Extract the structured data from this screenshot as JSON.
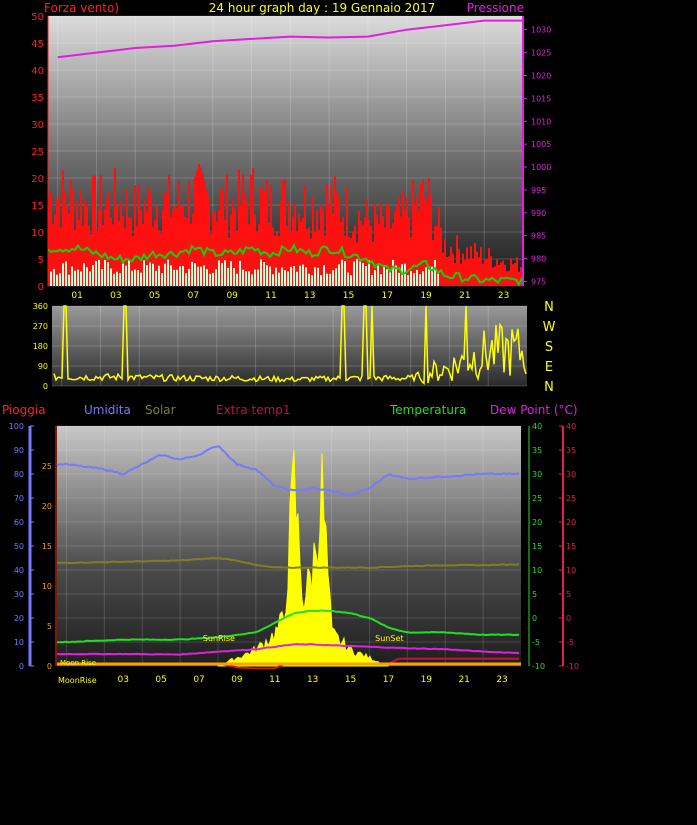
{
  "colors": {
    "background": "#000000",
    "wind": "#ff1010",
    "wind_avg": "#10d010",
    "gust_base": "#c8ffd8",
    "pressure": "#e020e0",
    "direction": "#ffff00",
    "humidity": "#7878ff",
    "solar": "#808020",
    "extra_temp": "#c01040",
    "temperature": "#20e020",
    "dew_point": "#e020e0",
    "rain": "#ffa000",
    "sun": "#ffff00",
    "hour_tick": "#ffff00"
  },
  "chart_data": [
    {
      "id": "wind-pressure",
      "type": "line",
      "title": "24 hour graph day : 19 Gennaio 2017",
      "left_label": "Forza vento)",
      "right_label": "Pressione",
      "x_ticks": [
        "01",
        "03",
        "05",
        "07",
        "09",
        "11",
        "13",
        "15",
        "17",
        "19",
        "21",
        "23"
      ],
      "y_left_ticks": [
        0,
        5,
        10,
        15,
        20,
        25,
        30,
        35,
        40,
        45,
        50
      ],
      "y_left_lim": [
        0,
        50
      ],
      "y_right_ticks": [
        975,
        980,
        985,
        990,
        995,
        1000,
        1005,
        1010,
        1015,
        1020,
        1025,
        1030
      ],
      "y_right_lim": [
        974,
        1033
      ],
      "grid": true,
      "series": [
        {
          "key": "wind_gust",
          "x": [
            0,
            1,
            2,
            3,
            4,
            5,
            6,
            7,
            8,
            9,
            10,
            11,
            12,
            13,
            14,
            15,
            16,
            17,
            18,
            19,
            20,
            21,
            22,
            23,
            24
          ],
          "values": [
            18,
            17,
            16,
            17,
            15,
            17,
            16,
            18,
            17,
            16,
            18,
            16,
            17,
            16,
            17,
            15,
            13,
            12,
            14,
            18,
            8,
            7,
            6,
            5,
            4
          ]
        },
        {
          "key": "wind_avg",
          "x": [
            0,
            1,
            2,
            3,
            4,
            5,
            6,
            7,
            8,
            9,
            10,
            11,
            12,
            13,
            14,
            15,
            16,
            17,
            18,
            19,
            20,
            21,
            22,
            23,
            24
          ],
          "values": [
            7,
            7,
            6,
            5,
            5,
            6,
            6,
            7,
            6,
            6,
            7,
            6,
            7,
            6,
            7,
            6,
            5,
            3,
            3,
            4,
            2,
            1.5,
            1,
            1,
            1
          ]
        },
        {
          "key": "pressure",
          "x": [
            0,
            2,
            4,
            6,
            8,
            10,
            12,
            14,
            16,
            18,
            20,
            22,
            24
          ],
          "values": [
            1024,
            1025,
            1026,
            1026.5,
            1027.5,
            1028,
            1028.5,
            1028.3,
            1028.5,
            1030,
            1031,
            1032,
            1032
          ]
        }
      ]
    },
    {
      "id": "wind-direction",
      "type": "line",
      "y_ticks": [
        0,
        90,
        180,
        270,
        360
      ],
      "y_lim": [
        0,
        360
      ],
      "compass_labels": [
        "N",
        "W",
        "S",
        "E",
        "N"
      ],
      "series": [
        {
          "key": "direction",
          "x": [
            0,
            3,
            6,
            9,
            12,
            15,
            18,
            19,
            20,
            21,
            22,
            23,
            24
          ],
          "values": [
            40,
            40,
            35,
            35,
            30,
            35,
            35,
            60,
            80,
            120,
            150,
            160,
            150
          ]
        }
      ]
    },
    {
      "id": "temp-humidity",
      "type": "line",
      "legend": [
        "Pioggia",
        "Umidita",
        "Solar",
        "Extra temp1",
        "Temperatura",
        "Dew Point (°C)"
      ],
      "x_ticks": [
        "01",
        "03",
        "05",
        "07",
        "09",
        "11",
        "13",
        "15",
        "17",
        "19",
        "21",
        "23"
      ],
      "hum_ticks": [
        0,
        10,
        20,
        30,
        40,
        50,
        60,
        70,
        80,
        90,
        100
      ],
      "rain_ticks": [
        0,
        5,
        10,
        15,
        20,
        25
      ],
      "temp_ticks": [
        -10,
        -5,
        0,
        5,
        10,
        15,
        20,
        25,
        30,
        35,
        40
      ],
      "dew_ticks": [
        -10,
        -5,
        0,
        5,
        10,
        15,
        20,
        25,
        30,
        35,
        40
      ],
      "annotations": {
        "sunrise": "SunRise",
        "sunset": "SunSet",
        "moonrise": "Moon Rise",
        "moonrise2": "MoonRise"
      },
      "series": [
        {
          "key": "humidity",
          "x": [
            0,
            2,
            3,
            5,
            6,
            7,
            8,
            9,
            10,
            11,
            12,
            13,
            14,
            15,
            16,
            17,
            18,
            20,
            22,
            24
          ],
          "values": [
            84,
            82,
            80,
            88,
            86,
            88,
            92,
            84,
            82,
            75,
            73,
            74,
            73,
            71,
            74,
            80,
            78,
            79,
            80,
            80
          ]
        },
        {
          "key": "solar",
          "x": [
            0,
            4,
            6,
            8,
            9,
            10,
            11,
            12,
            14,
            16,
            18,
            20,
            22,
            24
          ],
          "values": [
            11.5,
            11.8,
            12,
            12.5,
            12,
            11,
            10.5,
            10.5,
            10.5,
            10.5,
            10.8,
            11,
            11,
            11.2
          ]
        },
        {
          "key": "temperature",
          "x": [
            0,
            3,
            6,
            8,
            10,
            11,
            12,
            13,
            14,
            15,
            16,
            17,
            18,
            20,
            22,
            24
          ],
          "values": [
            -5,
            -4.5,
            -4.5,
            -4,
            -3,
            -1,
            1,
            1.5,
            1.5,
            1,
            0,
            -2,
            -3,
            -3,
            -3.5,
            -3.5
          ]
        },
        {
          "key": "dew_point",
          "x": [
            0,
            3,
            6,
            8,
            10,
            12,
            13,
            14,
            16,
            18,
            20,
            22,
            24
          ],
          "values": [
            -7.5,
            -7.5,
            -7.6,
            -7,
            -6.5,
            -5.5,
            -5.5,
            -5.7,
            -6,
            -6.3,
            -6.5,
            -7,
            -7.3
          ]
        },
        {
          "key": "extra_temp",
          "x": [
            0,
            8,
            9,
            10,
            11,
            11.5,
            12,
            16,
            17,
            17.5,
            24
          ],
          "values": [
            -9.5,
            -9.5,
            -10.3,
            -10.5,
            -10.5,
            -9.6,
            -9.6,
            -9.6,
            -9.6,
            -8.5,
            -8.5
          ]
        },
        {
          "key": "sun",
          "x": [
            8,
            9,
            10,
            11,
            11.5,
            12,
            12.5,
            13,
            13.5,
            14,
            15,
            16,
            17
          ],
          "values": [
            0,
            10,
            20,
            40,
            60,
            230,
            80,
            120,
            220,
            40,
            20,
            10,
            0
          ]
        }
      ]
    }
  ]
}
